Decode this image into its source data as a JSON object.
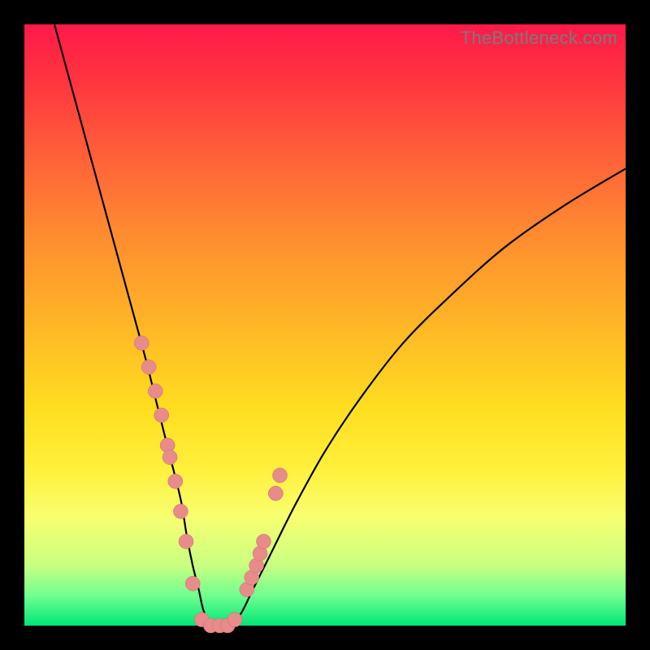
{
  "watermark": "TheBottleneck.com",
  "colors": {
    "dot_fill": "#e88b8b",
    "dot_stroke": "#d06a6a",
    "curve": "#000000",
    "gradient_top": "#ff1a4a",
    "gradient_bottom": "#00e676"
  },
  "chart_data": {
    "type": "line",
    "title": "",
    "xlabel": "",
    "ylabel": "",
    "xlim": [
      0,
      100
    ],
    "ylim": [
      0,
      100
    ],
    "grid": false,
    "legend": false,
    "series": [
      {
        "name": "bottleneck-curve",
        "x": [
          5,
          8,
          11,
          14,
          17,
          20,
          22,
          24,
          26,
          27,
          28,
          29,
          30,
          32,
          34,
          36,
          38,
          41,
          45,
          50,
          56,
          63,
          71,
          80,
          90,
          100
        ],
        "y": [
          100,
          89,
          78,
          67,
          56,
          45,
          37,
          29,
          21,
          15,
          10,
          6,
          2,
          0,
          0,
          2,
          6,
          12,
          20,
          29,
          38,
          47,
          55,
          63,
          70,
          76
        ]
      }
    ],
    "points": {
      "name": "highlight-dots",
      "x": [
        19.5,
        20.7,
        21.8,
        22.8,
        23.8,
        24.2,
        25.1,
        26.0,
        26.9,
        28.0,
        29.5,
        31.0,
        32.5,
        33.8,
        35.0,
        37.0,
        37.8,
        38.6,
        39.2,
        39.8,
        41.8,
        42.5
      ],
      "y": [
        47,
        43,
        39,
        35,
        30,
        28,
        24,
        19,
        14,
        7,
        1,
        0,
        0,
        0,
        1,
        6,
        8,
        10,
        12,
        14,
        22,
        25
      ]
    }
  }
}
